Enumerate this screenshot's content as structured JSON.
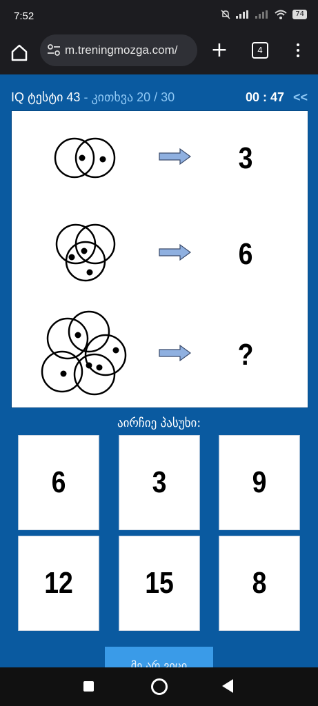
{
  "status_bar": {
    "time": "7:52",
    "battery": "74"
  },
  "browser": {
    "url": "m.treningmozga.com/",
    "tab_count": "4"
  },
  "quiz": {
    "test_label": "IQ ტესტი 43",
    "separator": " - ",
    "question_label": "კითხვა 20 / 30",
    "timer": "00 : 47",
    "back_label": "<<"
  },
  "puzzle": {
    "rows": [
      {
        "result": "3"
      },
      {
        "result": "6"
      },
      {
        "result": "?"
      }
    ]
  },
  "prompt": "აირჩიე პასუხი:",
  "answers": [
    "6",
    "3",
    "9",
    "12",
    "15",
    "8"
  ],
  "submit_label": "მე არ ვიცი"
}
